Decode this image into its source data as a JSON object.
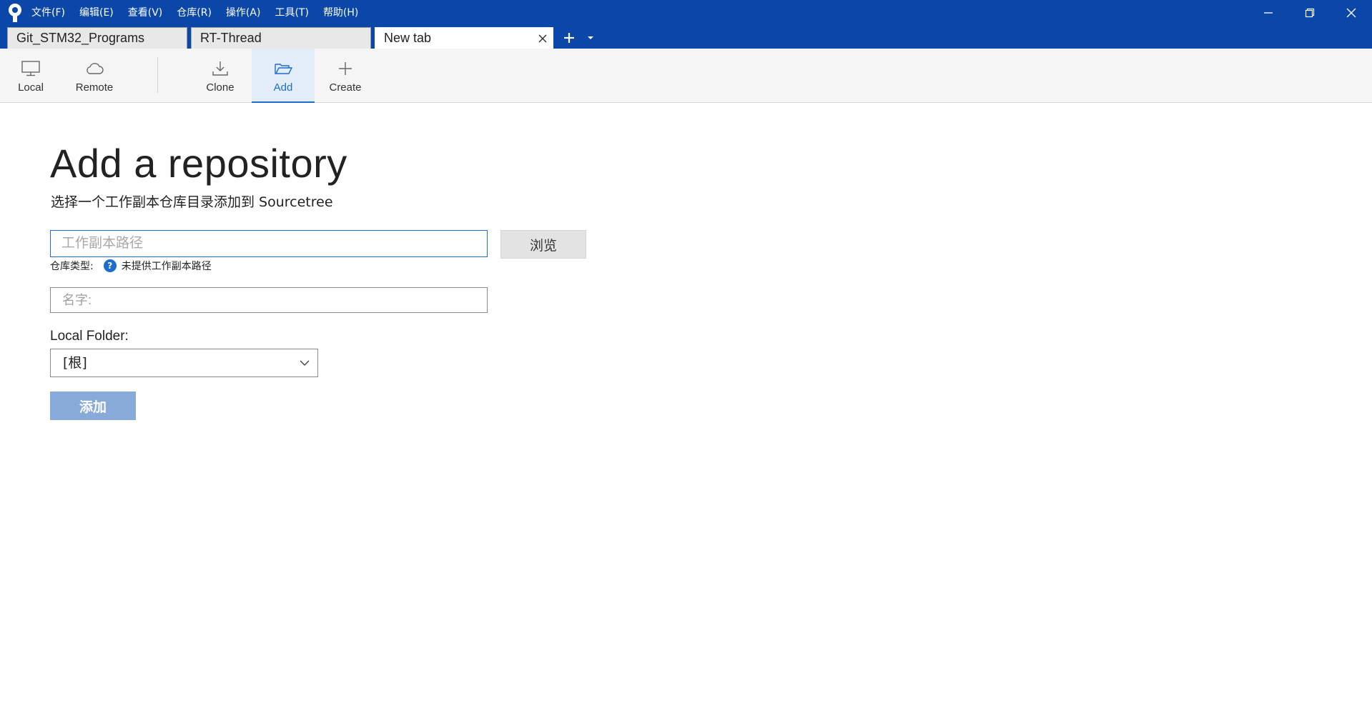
{
  "menu": [
    "文件(F)",
    "编辑(E)",
    "查看(V)",
    "仓库(R)",
    "操作(A)",
    "工具(T)",
    "帮助(H)"
  ],
  "tabs": [
    {
      "label": "Git_STM32_Programs"
    },
    {
      "label": "RT-Thread"
    },
    {
      "label": "New tab"
    }
  ],
  "toolbar": {
    "local": "Local",
    "remote": "Remote",
    "clone": "Clone",
    "add": "Add",
    "create": "Create",
    "selected": "add"
  },
  "main": {
    "title": "Add a repository",
    "subtitle": "选择一个工作副本仓库目录添加到 Sourcetree",
    "path_placeholder": "工作副本路径",
    "path_value": "",
    "browse_label": "浏览",
    "repo_type_label": "仓库类型:",
    "repo_type_value": "未提供工作副本路径",
    "name_placeholder": "名字:",
    "name_value": "",
    "folder_label": "Local Folder:",
    "folder_value": "[根]",
    "add_label": "添加"
  },
  "colors": {
    "titlebar": "#0a47a9",
    "accent": "#1c6dd0",
    "add_button_disabled": "#88aad9"
  },
  "icons": {
    "local": "monitor-icon",
    "remote": "cloud-icon",
    "clone": "download-icon",
    "add": "folder-open-icon",
    "create": "plus-icon"
  }
}
